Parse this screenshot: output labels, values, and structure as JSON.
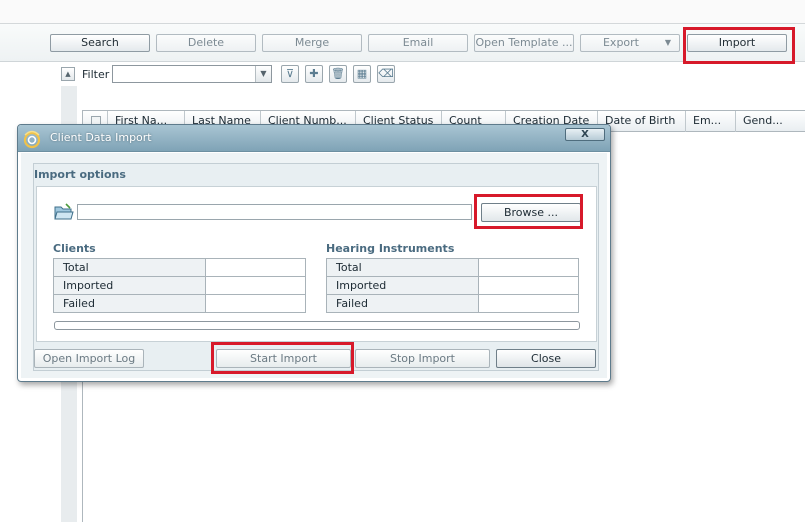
{
  "toolbar": {
    "buttons": [
      {
        "label": "Search",
        "enabled": true
      },
      {
        "label": "Delete",
        "enabled": false
      },
      {
        "label": "Merge",
        "enabled": false
      },
      {
        "label": "Email",
        "enabled": false
      },
      {
        "label": "Open Template ...",
        "enabled": false
      },
      {
        "label": "Export",
        "enabled": false
      },
      {
        "label": "Import",
        "enabled": true
      }
    ]
  },
  "filter": {
    "label": "Filter",
    "value": ""
  },
  "grid": {
    "columns": [
      "First Na...",
      "Last Name",
      "Client Numb...",
      "Client Status",
      "Count",
      "Creation Date",
      "Date of Birth",
      "Em...",
      "Gend..."
    ]
  },
  "dialog": {
    "title": "Client Data Import",
    "close_label": "X",
    "section_title": "Import options",
    "path_value": "",
    "browse_label": "Browse ...",
    "clients": {
      "title": "Clients",
      "rows": [
        {
          "label": "Total",
          "value": ""
        },
        {
          "label": "Imported",
          "value": ""
        },
        {
          "label": "Failed",
          "value": ""
        }
      ]
    },
    "instruments": {
      "title": "Hearing Instruments",
      "rows": [
        {
          "label": "Total",
          "value": ""
        },
        {
          "label": "Imported",
          "value": ""
        },
        {
          "label": "Failed",
          "value": ""
        }
      ]
    },
    "progress": 0,
    "buttons": {
      "open_log": "Open Import Log",
      "start": "Start Import",
      "stop": "Stop Import",
      "close": "Close"
    }
  },
  "colors": {
    "highlight": "#d7192a",
    "title_bar": "#8fb0c1",
    "accent": "#4a6b80"
  }
}
